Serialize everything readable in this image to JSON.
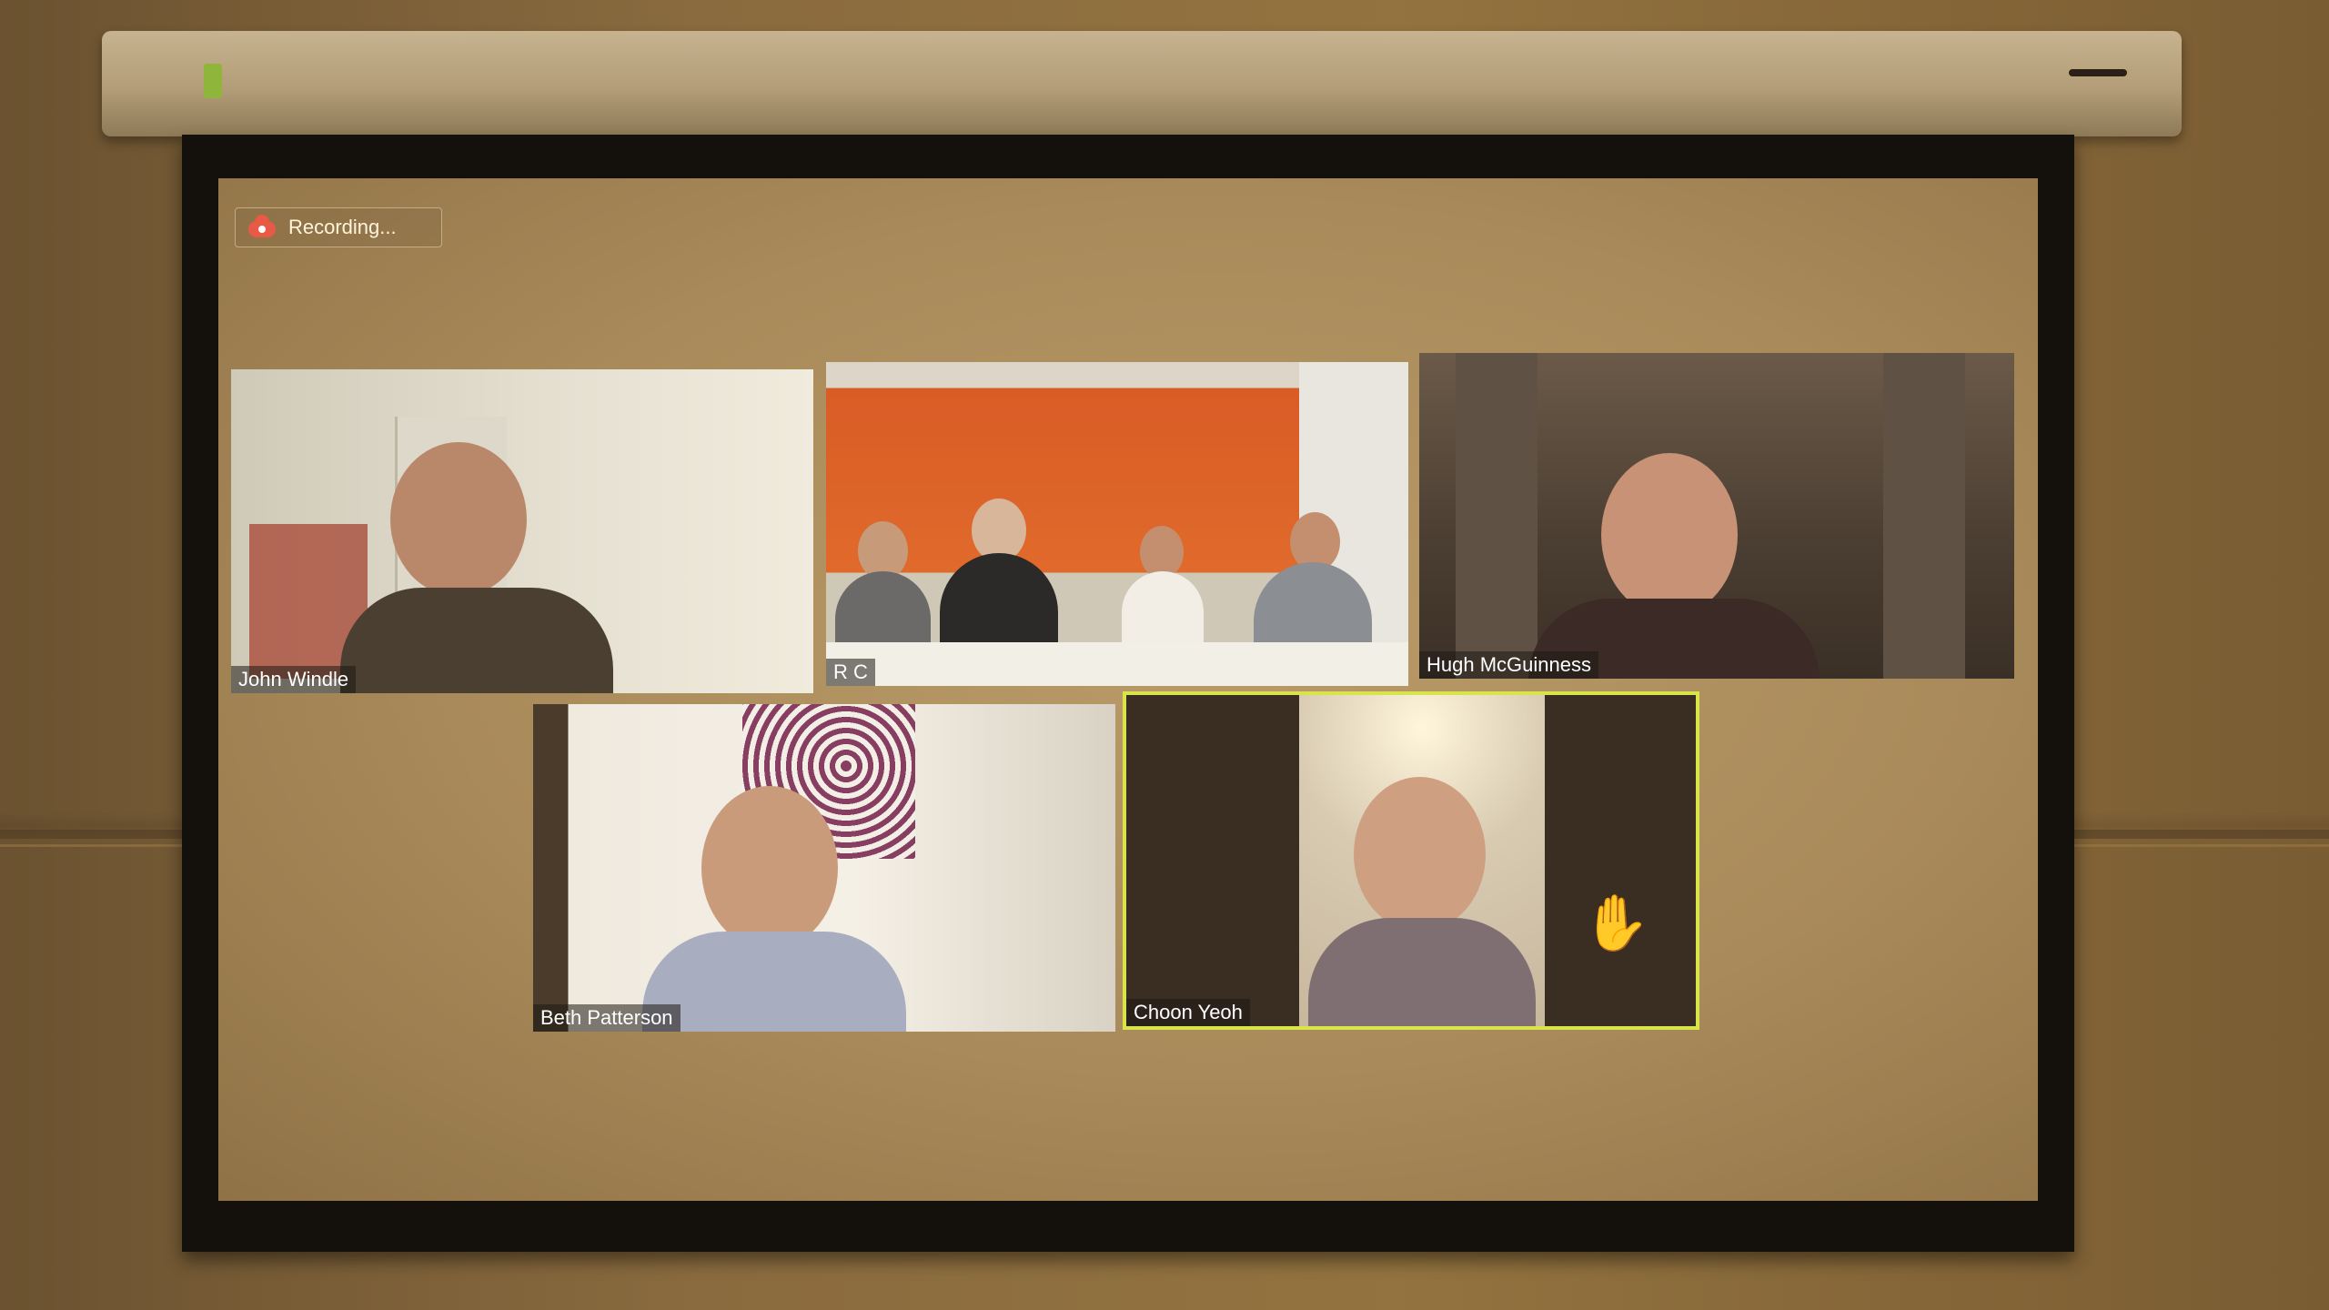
{
  "recording": {
    "label": "Recording..."
  },
  "participants": [
    {
      "name": "John Windle"
    },
    {
      "name": "R C"
    },
    {
      "name": "Hugh McGuinness"
    },
    {
      "name": "Beth Patterson"
    },
    {
      "name": "Choon Yeoh",
      "hand_raised": true,
      "active_speaker": true
    }
  ],
  "icons": {
    "recording": "cloud-record-icon",
    "raise_hand": "raised-hand-icon"
  },
  "colors": {
    "active_speaker_border": "#d9e34a",
    "recording_icon": "#e85a45"
  }
}
